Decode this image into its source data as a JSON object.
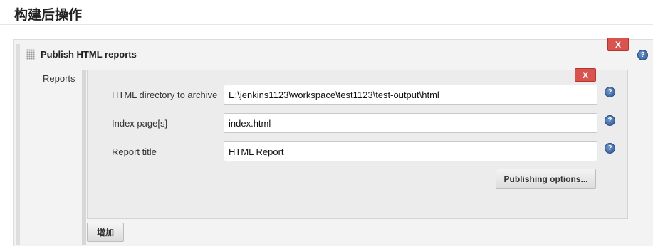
{
  "section": {
    "title": "构建后操作"
  },
  "publisher": {
    "title": "Publish HTML reports",
    "delete_label": "X",
    "help_label": "?"
  },
  "reports": {
    "label": "Reports",
    "delete_label": "X",
    "fields": [
      {
        "label": "HTML directory to archive",
        "value": "E:\\jenkins1123\\workspace\\test1123\\test-output\\html",
        "help_label": "?"
      },
      {
        "label": "Index page[s]",
        "value": "index.html",
        "help_label": "?"
      },
      {
        "label": "Report title",
        "value": "HTML Report",
        "help_label": "?"
      }
    ],
    "publishing_options_label": "Publishing options..."
  },
  "add_button_label": "增加",
  "colors": {
    "delete_red": "#d9534f",
    "help_blue": "#2c5a9a",
    "panel_gray": "#ececec"
  }
}
